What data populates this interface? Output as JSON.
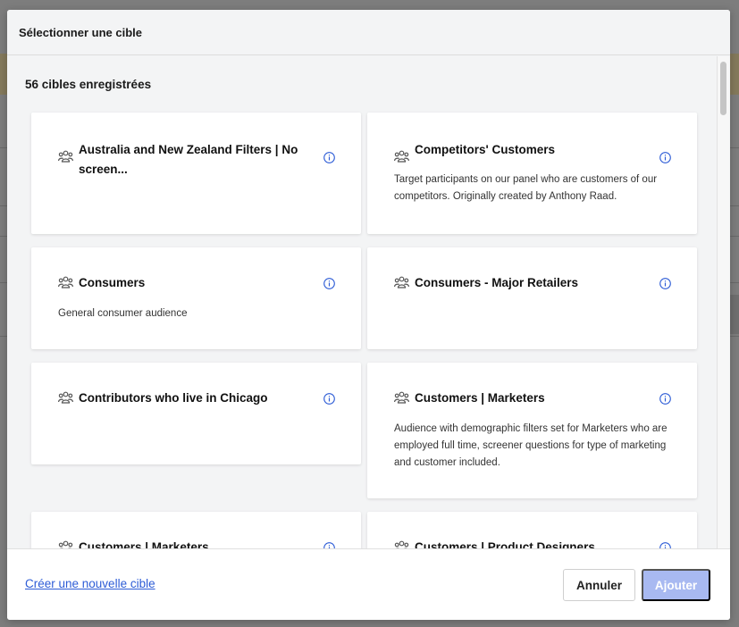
{
  "modal": {
    "title": "Sélectionner une cible",
    "count_label": "56 cibles enregistrées"
  },
  "cards": [
    {
      "title": "Australia and New Zealand Filters | No screen...",
      "description": ""
    },
    {
      "title": "Competitors' Customers",
      "description": "Target participants on our panel who are customers of our competitors. Originally created by Anthony Raad."
    },
    {
      "title": "Consumers",
      "description": "General consumer audience"
    },
    {
      "title": "Consumers - Major Retailers",
      "description": ""
    },
    {
      "title": "Contributors who live in Chicago",
      "description": ""
    },
    {
      "title": "Customers | Marketers",
      "description": "Audience with demographic filters set for Marketers who are employed full time, screener questions for type of marketing and customer included."
    },
    {
      "title": "Customers | Marketers",
      "description": ""
    },
    {
      "title": "Customers | Product Designers",
      "description": ""
    }
  ],
  "footer": {
    "create_link": "Créer une nouvelle cible",
    "cancel_label": "Annuler",
    "add_label": "Ajouter"
  },
  "colors": {
    "link": "#2d5cd6",
    "primary_disabled": "#a8b9f1",
    "info_icon": "#2d5cd6"
  },
  "icons": {
    "card": "audience-group-icon",
    "info": "info-icon"
  }
}
